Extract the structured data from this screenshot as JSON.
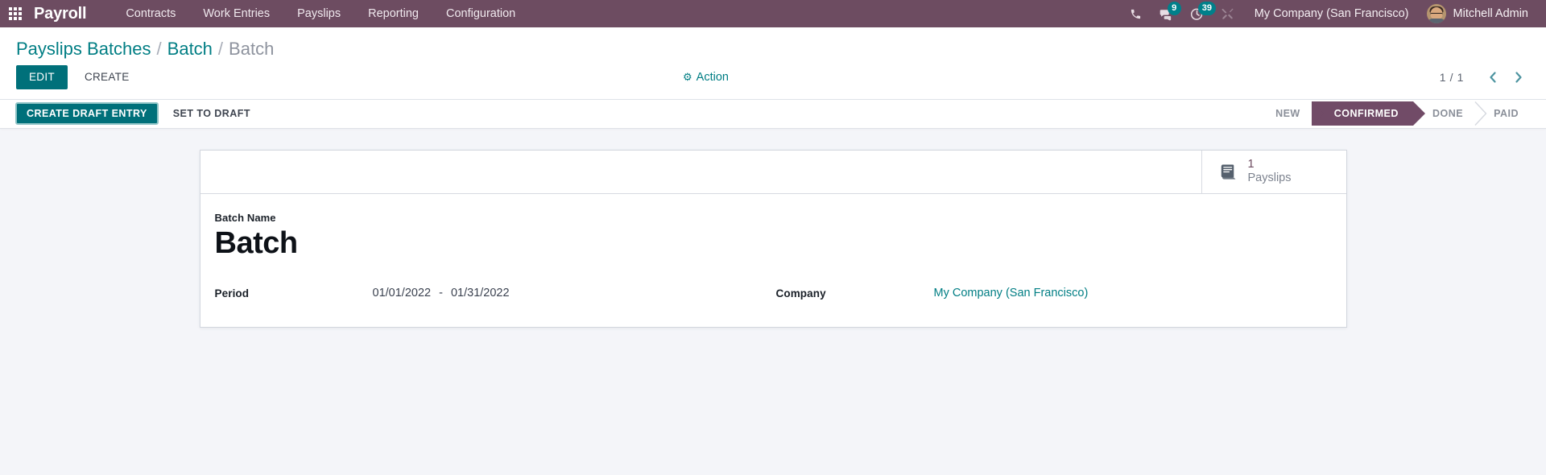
{
  "navbar": {
    "apps_icon": "apps-grid-icon",
    "brand": "Payroll",
    "menu": [
      {
        "label": "Contracts"
      },
      {
        "label": "Work Entries"
      },
      {
        "label": "Payslips"
      },
      {
        "label": "Reporting"
      },
      {
        "label": "Configuration"
      }
    ],
    "sys_icons": [
      {
        "name": "phone-icon",
        "badge": null
      },
      {
        "name": "messages-icon",
        "badge": "9"
      },
      {
        "name": "activities-clock-icon",
        "badge": "39"
      },
      {
        "name": "tools-icon",
        "badge": null
      }
    ],
    "company": "My Company (San Francisco)",
    "user": "Mitchell Admin",
    "colors": {
      "bar_bg": "#6d4c61",
      "badge_bg": "#00808a"
    }
  },
  "breadcrumb": {
    "items": [
      {
        "label": "Payslips Batches",
        "active": false
      },
      {
        "label": "Batch",
        "active": false
      },
      {
        "label": "Batch",
        "active": true
      }
    ],
    "separator": "/"
  },
  "control_panel": {
    "edit_label": "EDIT",
    "create_label": "CREATE",
    "action_label": "Action",
    "action_icon": "gear-icon",
    "pager": {
      "count": "1 / 1",
      "prev_icon": "chevron-left-icon",
      "next_icon": "chevron-right-icon"
    }
  },
  "statusbar_row": {
    "buttons": [
      {
        "label": "CREATE DRAFT ENTRY",
        "primary": true
      },
      {
        "label": "SET TO DRAFT",
        "primary": false
      }
    ],
    "states": [
      {
        "label": "NEW",
        "active": false
      },
      {
        "label": "CONFIRMED",
        "active": true
      },
      {
        "label": "DONE",
        "active": false
      },
      {
        "label": "PAID",
        "active": false
      }
    ],
    "active_color": "#714b67"
  },
  "sheet": {
    "stat_button": {
      "icon": "book-icon",
      "value": "1",
      "label": "Payslips"
    },
    "name_field": {
      "label": "Batch Name",
      "value": "Batch"
    },
    "period": {
      "label": "Period",
      "date_from": "01/01/2022",
      "separator": "-",
      "date_to": "01/31/2022"
    },
    "company": {
      "label": "Company",
      "value": "My Company (San Francisco)"
    }
  }
}
